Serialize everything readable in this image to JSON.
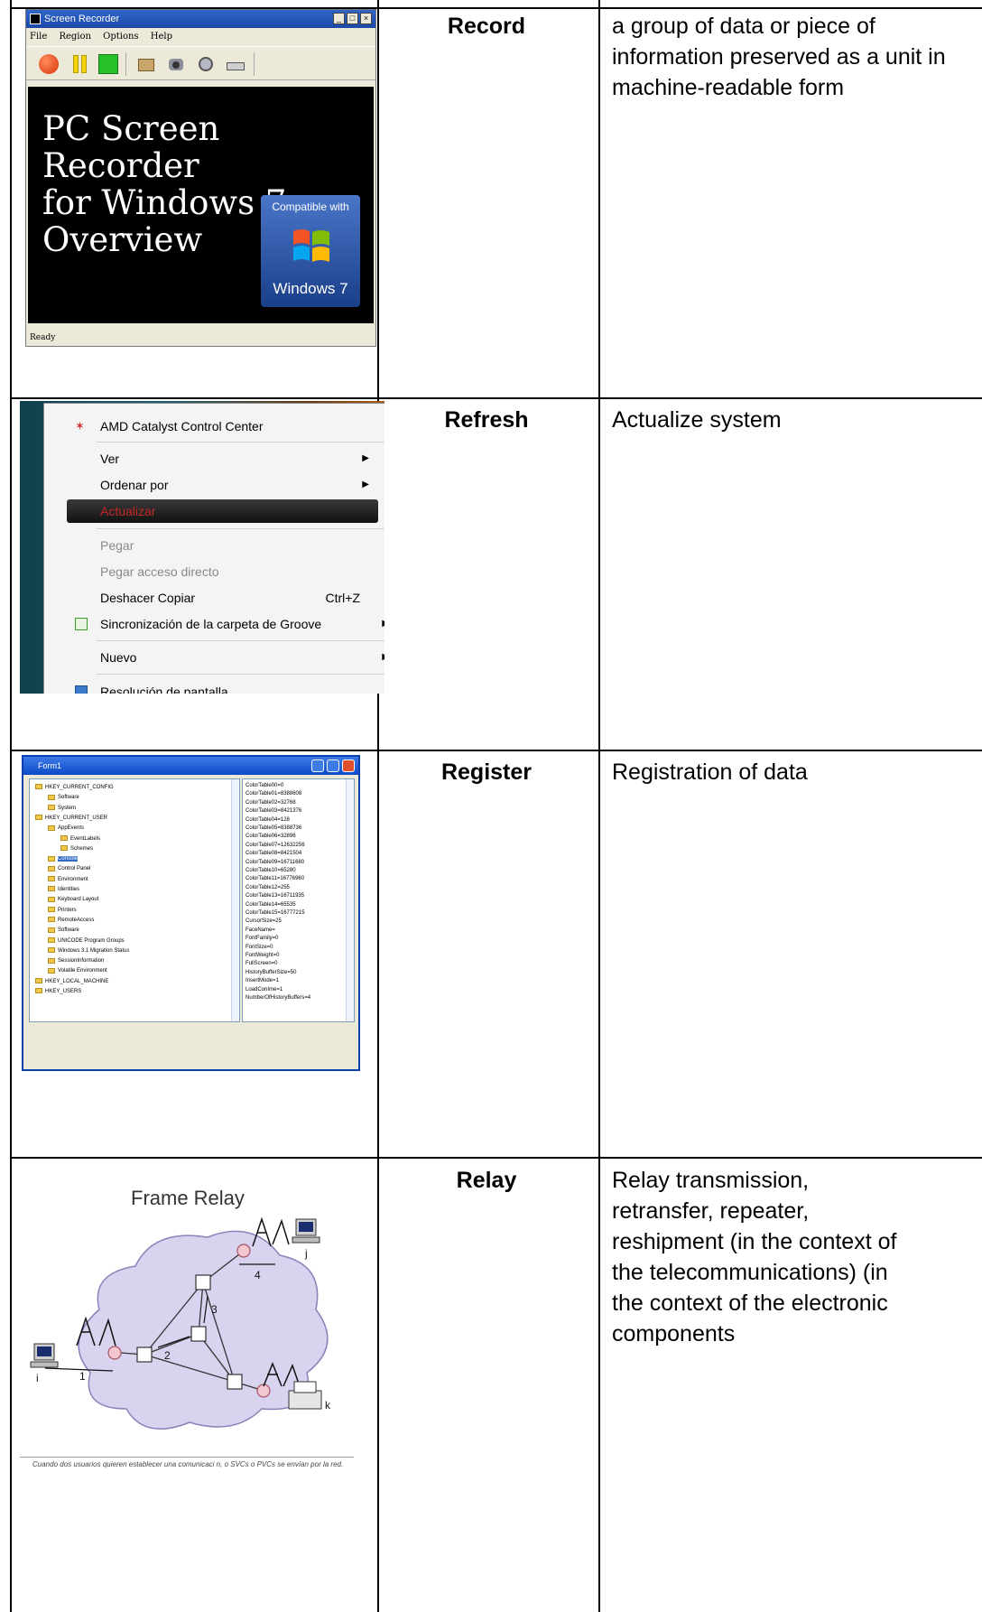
{
  "rows": [
    {
      "term": "Record",
      "definition": "a group of data or piece of information preserved as a unit in machine-readable form"
    },
    {
      "term": "Refresh",
      "definition": "Actualize system"
    },
    {
      "term": "Register",
      "definition": "Registration of data"
    },
    {
      "term": "Relay",
      "definition_lines": [
        "Relay transmission,",
        "retransfer, repeater,",
        "reshipment (in the context of",
        "the telecommunications) (in",
        "the context of the electronic",
        "components"
      ]
    }
  ],
  "screen_recorder": {
    "title": "Screen Recorder",
    "window_controls": [
      "_",
      "□",
      "×"
    ],
    "menu": [
      "File",
      "Region",
      "Options",
      "Help"
    ],
    "video_title": "PC Screen Recorder\nfor Windows 7\nOverview",
    "badge_compat": "Compatible with",
    "badge_name": "Windows 7",
    "status": "Ready"
  },
  "context_menu": {
    "items": [
      {
        "label": "AMD Catalyst Control Center",
        "state": "normal"
      },
      {
        "label": "Ver",
        "state": "normal",
        "submenu": true
      },
      {
        "label": "Ordenar por",
        "state": "normal",
        "submenu": true
      },
      {
        "label": "Actualizar",
        "state": "highlighted"
      },
      {
        "label": "Pegar",
        "state": "disabled"
      },
      {
        "label": "Pegar acceso directo",
        "state": "disabled"
      },
      {
        "label": "Deshacer Copiar",
        "state": "normal",
        "shortcut": "Ctrl+Z"
      },
      {
        "label": "Sincronización de la carpeta de Groove",
        "state": "normal",
        "submenu": true
      },
      {
        "label": "Nuevo",
        "state": "normal",
        "submenu": true
      },
      {
        "label": "Resolución de pantalla",
        "state": "normal"
      }
    ]
  },
  "registry_form": {
    "title": "Form1",
    "tree": [
      "HKEY_CURRENT_CONFIG",
      "Software",
      "System",
      "HKEY_CURRENT_USER",
      "AppEvents",
      "EventLabels",
      "Schemes",
      "Console",
      "Control Panel",
      "Environment",
      "Identities",
      "Keyboard Layout",
      "Printers",
      "RemoteAccess",
      "Software",
      "UNICODE Program Groups",
      "Windows 3.1 Migration Status",
      "SessionInformation",
      "Volatile Environment",
      "HKEY_LOCAL_MACHINE",
      "HKEY_USERS"
    ],
    "values": [
      "ColorTable00=0",
      "ColorTable01=8388608",
      "ColorTable02=32768",
      "ColorTable03=8421376",
      "ColorTable04=128",
      "ColorTable05=8388736",
      "ColorTable06=32896",
      "ColorTable07=12632256",
      "ColorTable08=8421504",
      "ColorTable09=16711680",
      "ColorTable10=65280",
      "ColorTable11=16776960",
      "ColorTable12=255",
      "ColorTable13=16711935",
      "ColorTable14=65535",
      "ColorTable15=16777215",
      "CursorSize=25",
      "FaceName=",
      "FontFamily=0",
      "FontSize=0",
      "FontWeight=0",
      "FullScreen=0",
      "HistoryBufferSize=50",
      "InsertMode=1",
      "LoadConIme=1",
      "NumberOfHistoryBuffers=4"
    ]
  },
  "frame_relay": {
    "title": "Frame Relay",
    "caption": "Cuando dos usuarios quieren establecer una comunicaci n, o SVCs o PVCs se envían por la red.",
    "labels": [
      "1",
      "2",
      "3",
      "4",
      "i",
      "j",
      "k"
    ]
  },
  "colors": {
    "grid": "#000000",
    "video_bg": "#000000",
    "menu_highlight_text": "#c62828",
    "cloud": "#d9d3f0"
  }
}
